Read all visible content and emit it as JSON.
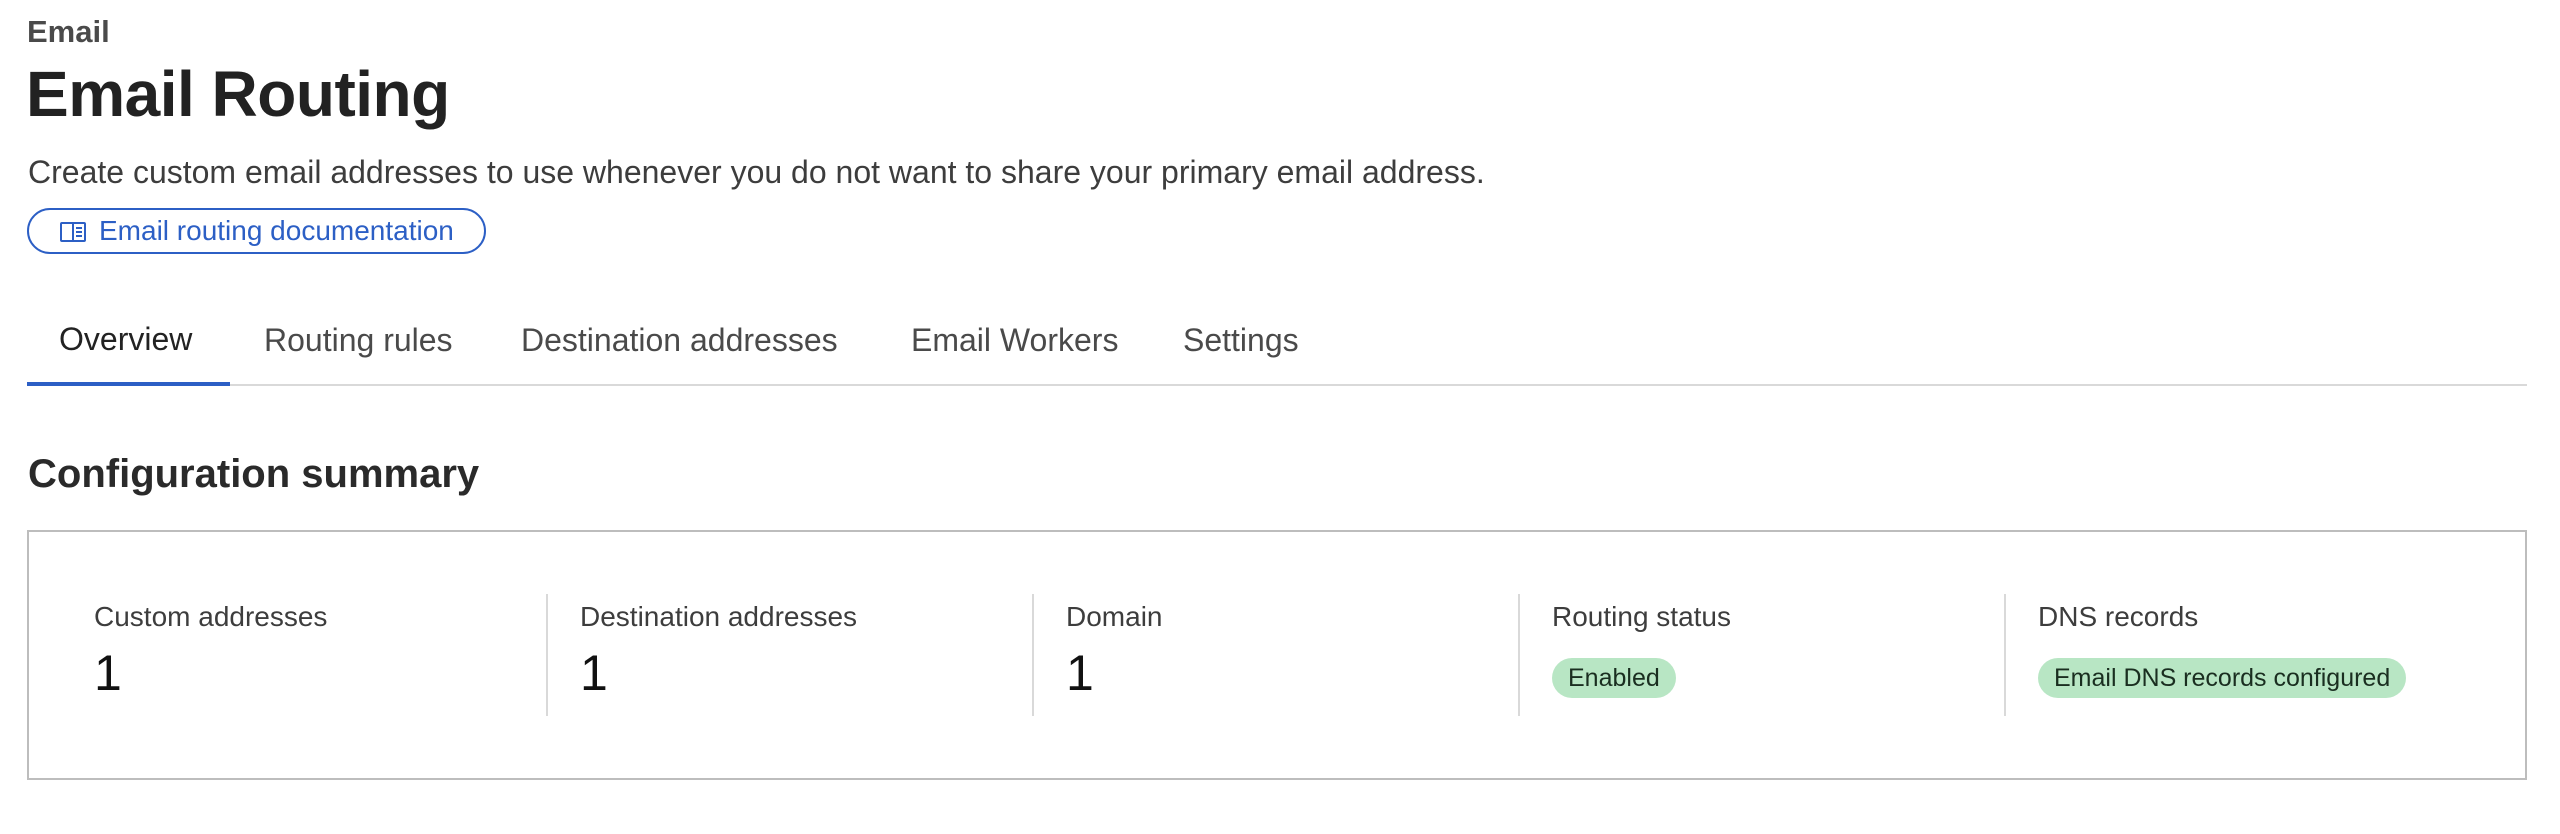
{
  "breadcrumb": "Email",
  "title": "Email Routing",
  "description": "Create custom email addresses to use whenever you do not want to share your primary email address.",
  "doc_link": {
    "label": "Email routing documentation",
    "icon": "book-open-icon"
  },
  "tabs": [
    {
      "label": "Overview",
      "active": true
    },
    {
      "label": "Routing rules",
      "active": false
    },
    {
      "label": "Destination addresses",
      "active": false
    },
    {
      "label": "Email Workers",
      "active": false
    },
    {
      "label": "Settings",
      "active": false
    }
  ],
  "summary": {
    "title": "Configuration summary",
    "stats": [
      {
        "label": "Custom addresses",
        "value": "1"
      },
      {
        "label": "Destination addresses",
        "value": "1"
      },
      {
        "label": "Domain",
        "value": "1"
      },
      {
        "label": "Routing status",
        "badge": "Enabled"
      },
      {
        "label": "DNS records",
        "badge": "Email DNS records configured"
      }
    ]
  },
  "colors": {
    "accent": "#2c5fc5",
    "badge_bg": "#b8e6c4",
    "border": "#bdbdbd",
    "divider": "#d9d9d9"
  }
}
